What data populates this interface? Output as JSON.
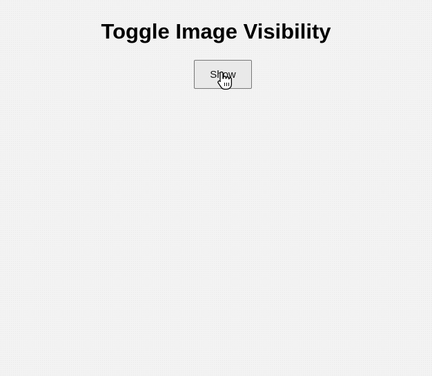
{
  "page": {
    "title": "Toggle Image Visibility"
  },
  "toggle_button": {
    "label": "Show"
  },
  "icons": {
    "cursor": "hand-pointer-cursor-icon"
  },
  "colors": {
    "background": "#f3f3f3",
    "button_background": "#e9e9e9",
    "button_border": "#767676",
    "text": "#000000"
  }
}
